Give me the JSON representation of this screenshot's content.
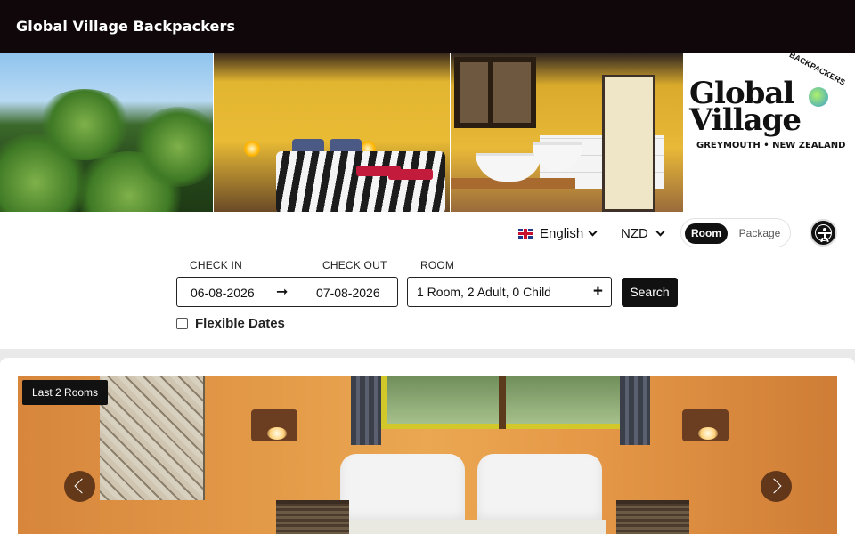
{
  "header": {
    "title": "Global Village Backpackers"
  },
  "banner": {
    "logo": {
      "line1": "Global",
      "line2": "Village",
      "arc_text": "BACKPACKERS",
      "tagline": "GREYMOUTH • NEW ZEALAND"
    }
  },
  "controls": {
    "language": "English",
    "currency": "NZD",
    "mode_toggle": {
      "room": "Room",
      "package": "Package",
      "selected": "Room"
    },
    "accessibility_icon": "accessibility-person-icon"
  },
  "booking": {
    "check_in_label": "CHECK IN",
    "check_out_label": "CHECK OUT",
    "room_label": "ROOM",
    "check_in_value": "06-08-2026",
    "check_out_value": "07-08-2026",
    "date_arrow": "➞",
    "room_value": "1 Room, 2 Adult, 0 Child",
    "room_plus": "+",
    "search_label": "Search",
    "flexible_dates_label": "Flexible Dates",
    "flexible_dates_checked": false
  },
  "room_card": {
    "badge": "Last 2 Rooms"
  }
}
